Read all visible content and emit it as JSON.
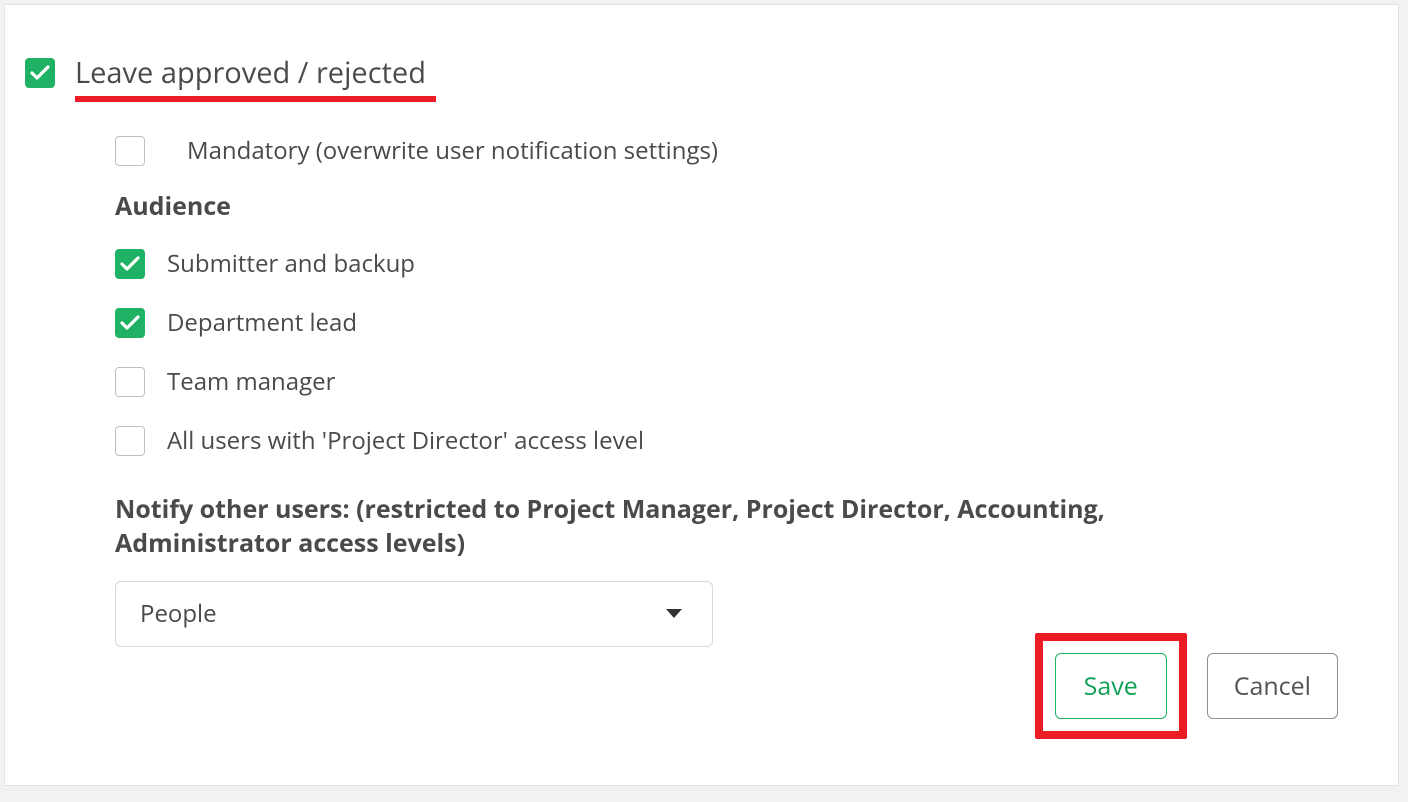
{
  "heading": {
    "checked": true,
    "label": "Leave approved / rejected"
  },
  "mandatory": {
    "checked": false,
    "label": "Mandatory (overwrite user notification settings)"
  },
  "audience": {
    "title": "Audience",
    "items": [
      {
        "label": "Submitter and backup",
        "checked": true
      },
      {
        "label": "Department lead",
        "checked": true
      },
      {
        "label": "Team manager",
        "checked": false
      },
      {
        "label": "All users with 'Project Director' access level",
        "checked": false
      }
    ]
  },
  "notify": {
    "title": "Notify other users: (restricted to Project Manager, Project Director, Accounting, Administrator access levels)",
    "dropdown_value": "People"
  },
  "buttons": {
    "save": "Save",
    "cancel": "Cancel"
  },
  "colors": {
    "accent_green": "#1fb264",
    "highlight_red": "#ec1c24"
  }
}
